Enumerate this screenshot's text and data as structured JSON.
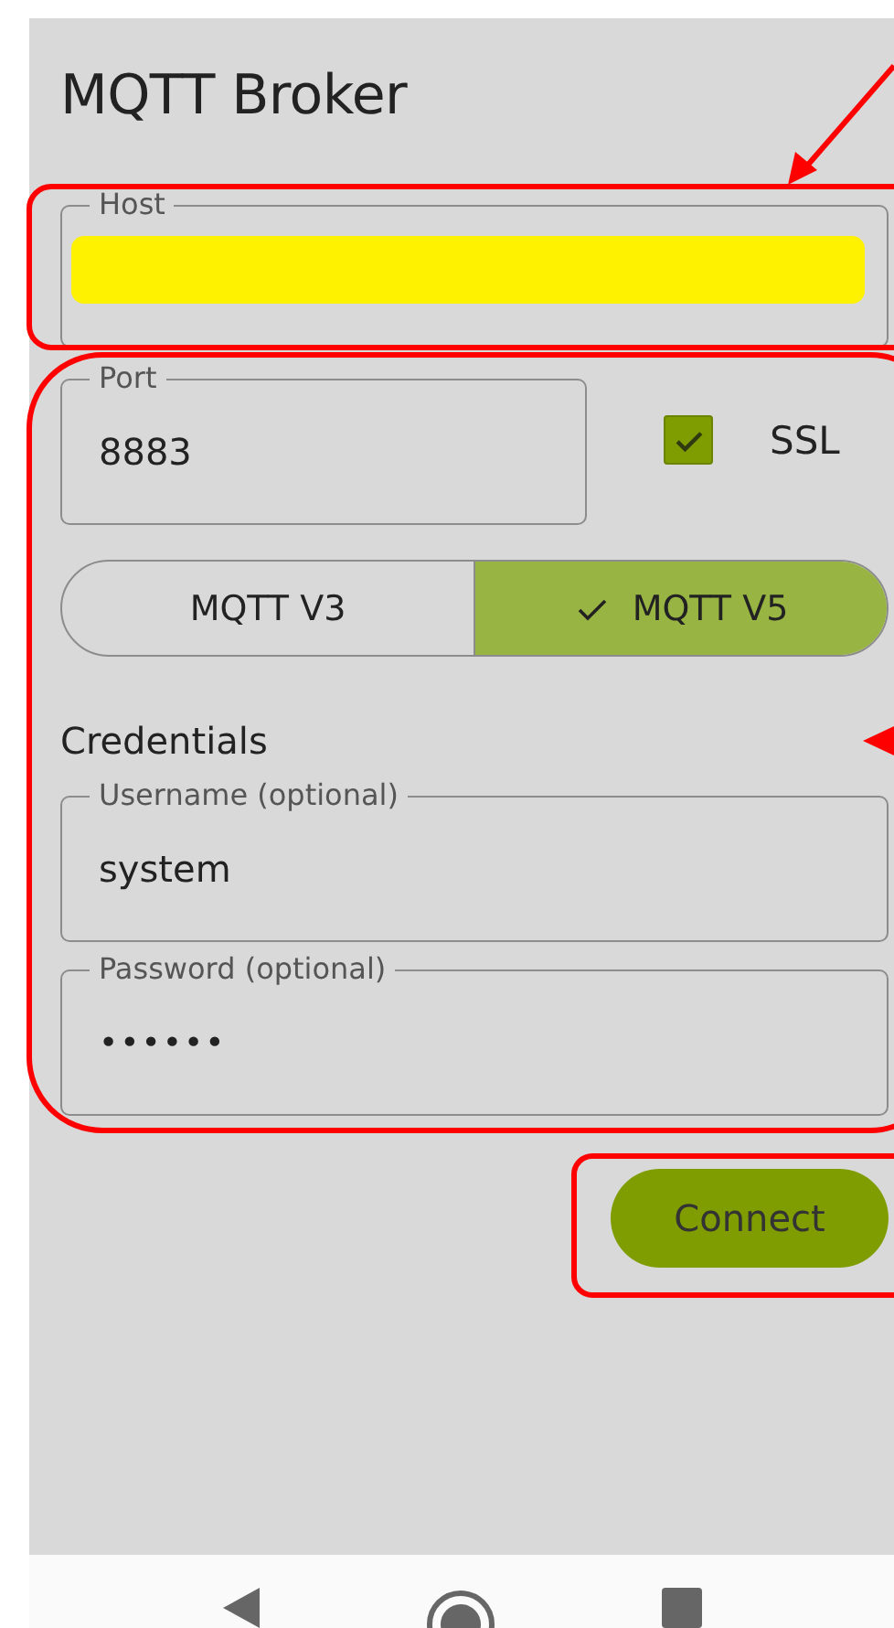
{
  "title": "MQTT Broker",
  "host": {
    "label": "Host",
    "redacted": true
  },
  "port": {
    "label": "Port",
    "value": "8883"
  },
  "ssl": {
    "label": "SSL",
    "checked": true
  },
  "protocol_versions": [
    {
      "label": "MQTT V3",
      "selected": false
    },
    {
      "label": "MQTT V5",
      "selected": true
    }
  ],
  "credentials": {
    "heading": "Credentials",
    "username": {
      "label": "Username (optional)",
      "value": "system"
    },
    "password": {
      "label": "Password (optional)",
      "value": "••••••"
    }
  },
  "connect_button": "Connect"
}
